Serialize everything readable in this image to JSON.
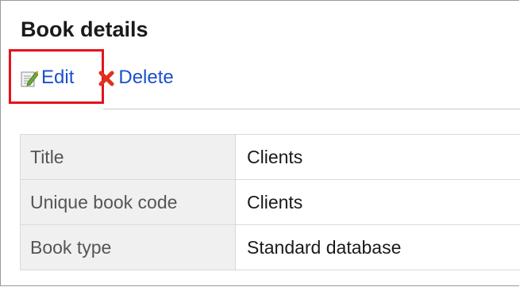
{
  "page": {
    "title": "Book details"
  },
  "toolbar": {
    "edit_label": "Edit",
    "delete_label": "Delete",
    "edit_icon": "edit-pencil-icon",
    "delete_icon": "delete-x-icon"
  },
  "colors": {
    "link": "#1a4fd0",
    "highlight": "#e3141d",
    "delete_icon": "#e0301e",
    "label_background": "#f0f0f0"
  },
  "details": {
    "rows": [
      {
        "label": "Title",
        "value": "Clients"
      },
      {
        "label": "Unique book code",
        "value": "Clients"
      },
      {
        "label": "Book type",
        "value": "Standard database"
      }
    ]
  }
}
